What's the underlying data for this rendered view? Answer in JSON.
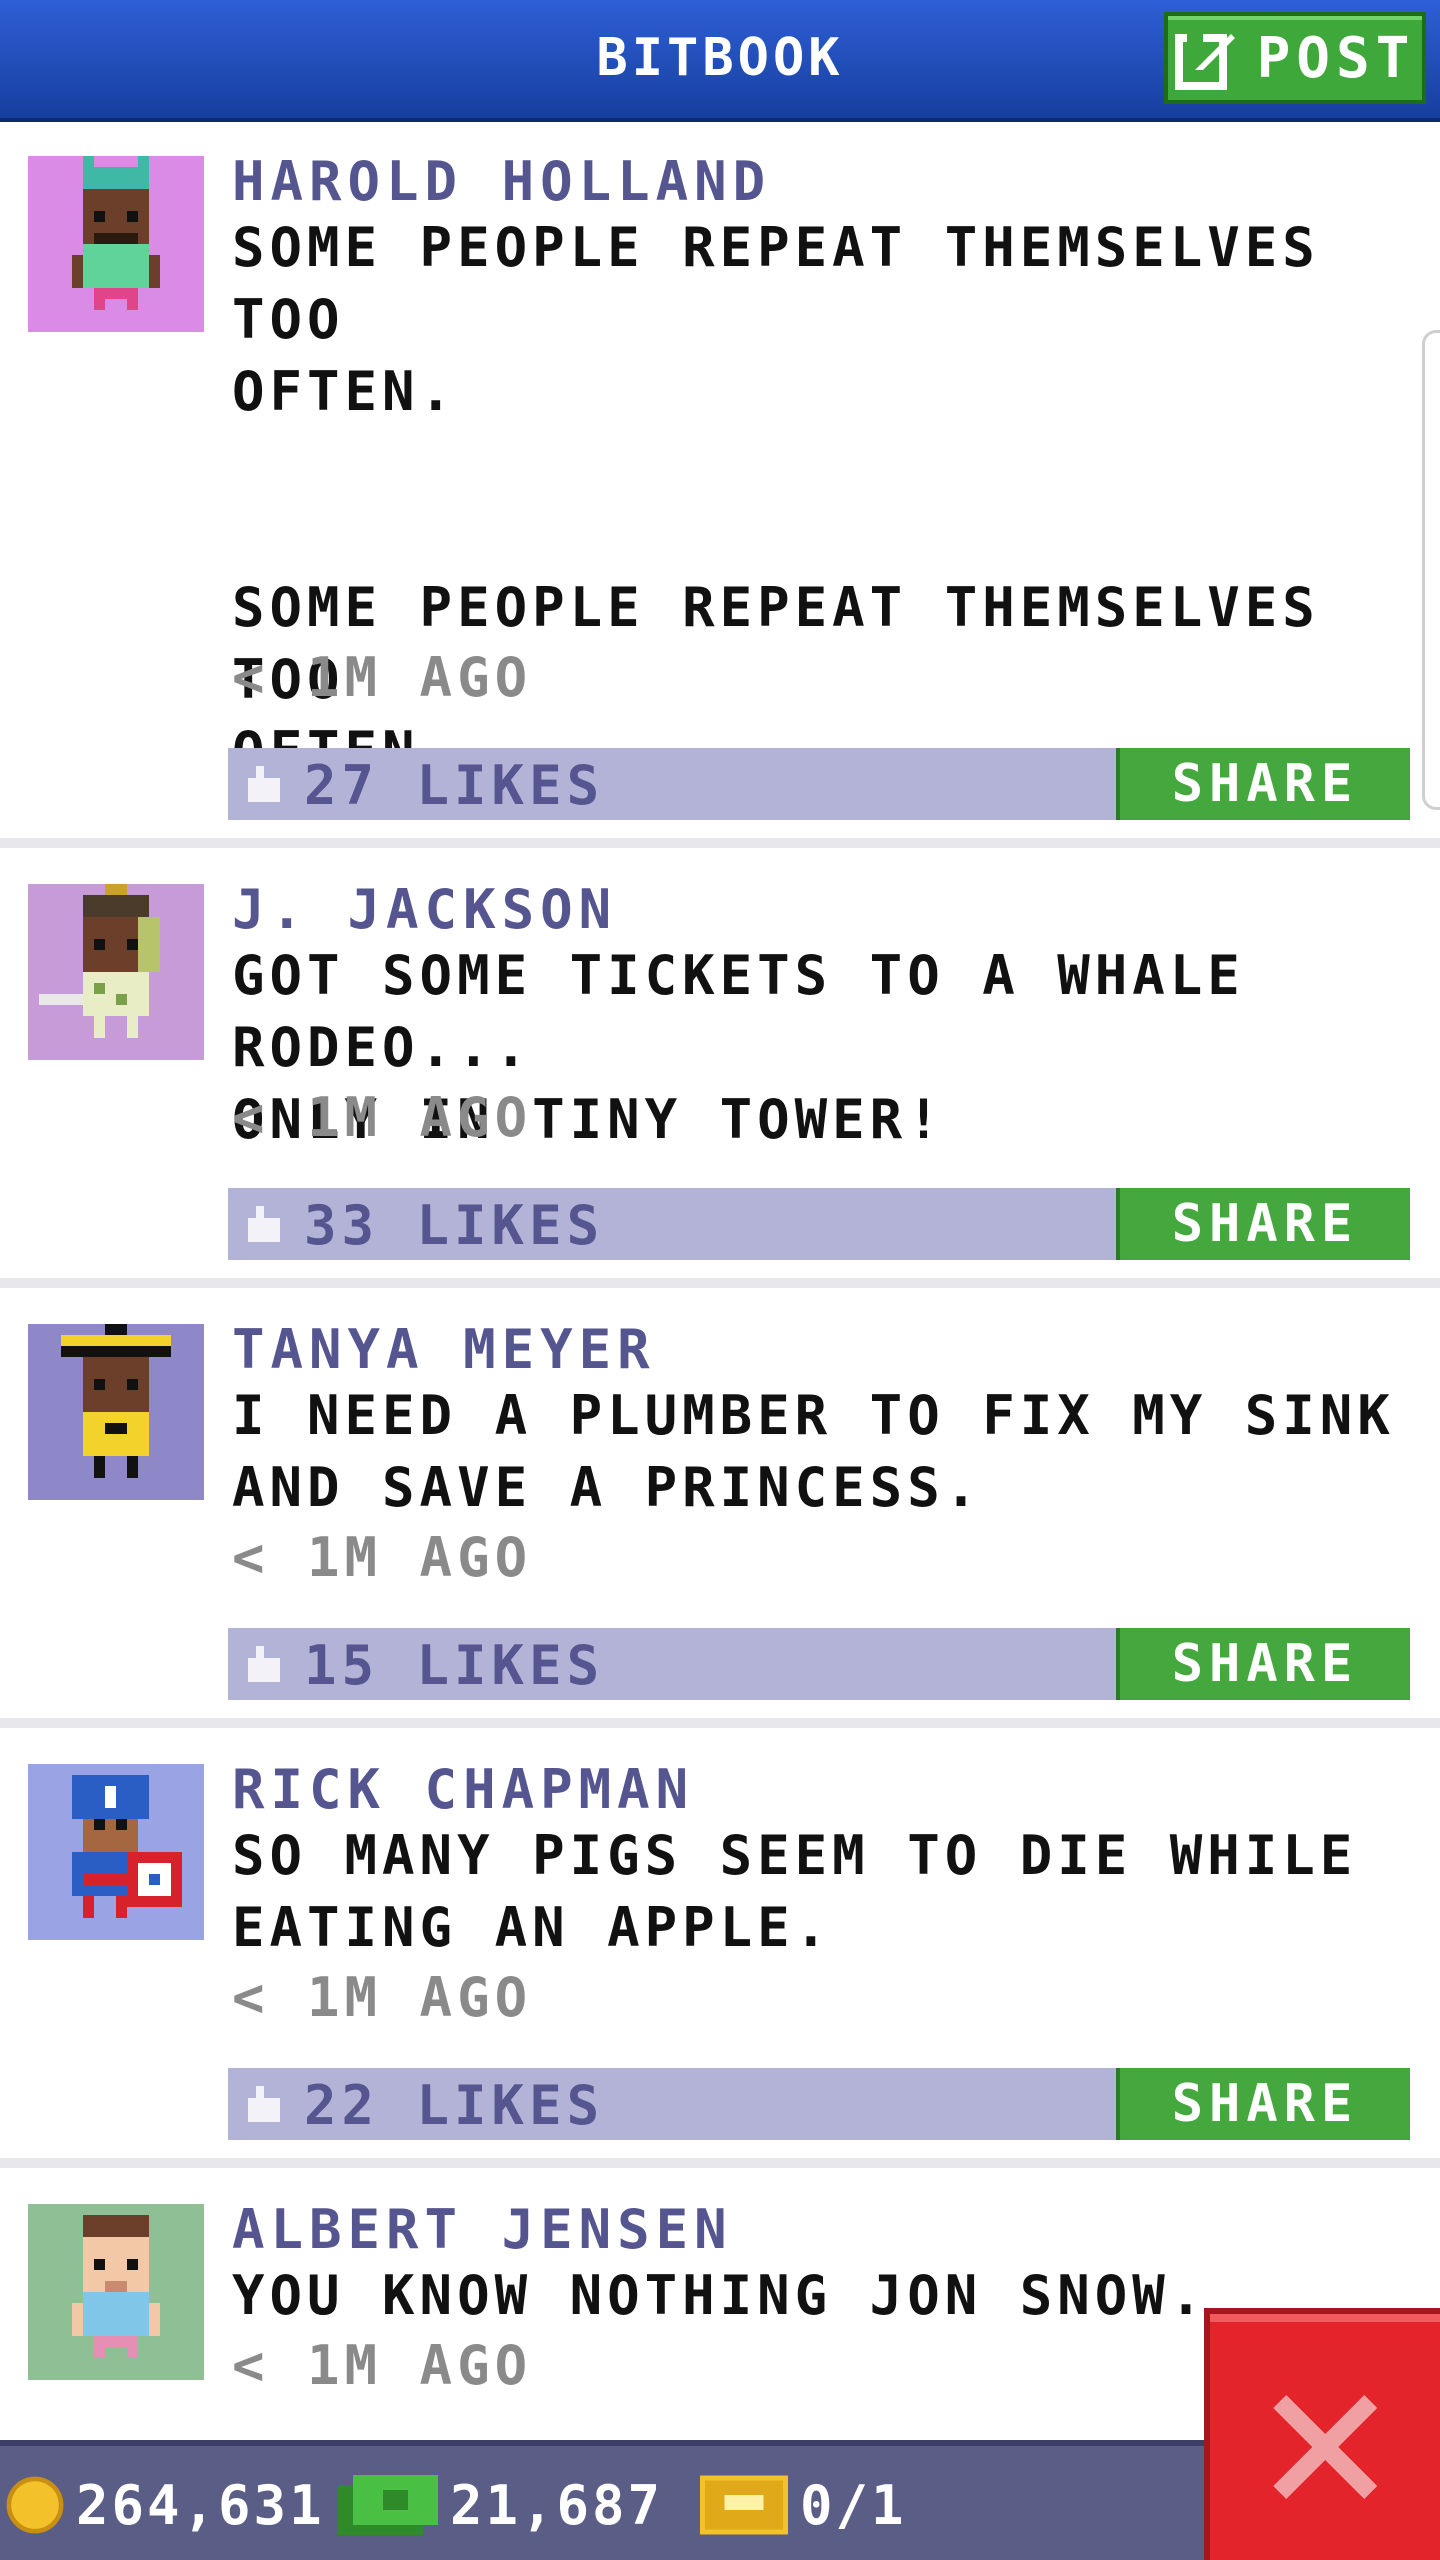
{
  "header": {
    "title": "BITBOOK",
    "post_label": "POST"
  },
  "posts": [
    {
      "author": "HAROLD HOLLAND",
      "message": "SOME PEOPLE REPEAT THEMSELVES TOO\nOFTEN.\n\n\nSOME PEOPLE REPEAT THEMSELVES TOO\nOFTEN.",
      "time": "< 1M AGO",
      "likes": "27 LIKES",
      "share_label": "SHARE",
      "avatar_bg": "#d98be6"
    },
    {
      "author": "J. JACKSON",
      "message": "GOT SOME TICKETS TO A WHALE RODEO...\nONLY IN TINY TOWER!",
      "time": "< 1M AGO",
      "likes": "33 LIKES",
      "share_label": "SHARE",
      "avatar_bg": "#c79ad8"
    },
    {
      "author": "TANYA MEYER",
      "message": "I NEED A PLUMBER TO FIX MY SINK\nAND SAVE A PRINCESS.",
      "time": "< 1M AGO",
      "likes": "15 LIKES",
      "share_label": "SHARE",
      "avatar_bg": "#8f88c8"
    },
    {
      "author": "RICK CHAPMAN",
      "message": "SO MANY PIGS SEEM TO DIE WHILE\nEATING AN APPLE.",
      "time": "< 1M AGO",
      "likes": "22 LIKES",
      "share_label": "SHARE",
      "avatar_bg": "#9aa3e3"
    },
    {
      "author": "ALBERT JENSEN",
      "message": "YOU KNOW NOTHING JON SNOW.",
      "time": "< 1M AGO",
      "avatar_bg": "#8fbf95"
    }
  ],
  "footer": {
    "coins": "264,631",
    "bux": "21,687",
    "vip": "0/1"
  },
  "colors": {
    "header_blue": "#2f5fd6",
    "button_green": "#45a83e",
    "likes_bar": "#b2b3d6",
    "name_purple": "#55558f",
    "close_red": "#e3242b"
  },
  "icons": [
    "compose-icon",
    "like-icon",
    "coin-icon",
    "bux-icon",
    "vip-ticket-icon",
    "close-icon"
  ]
}
